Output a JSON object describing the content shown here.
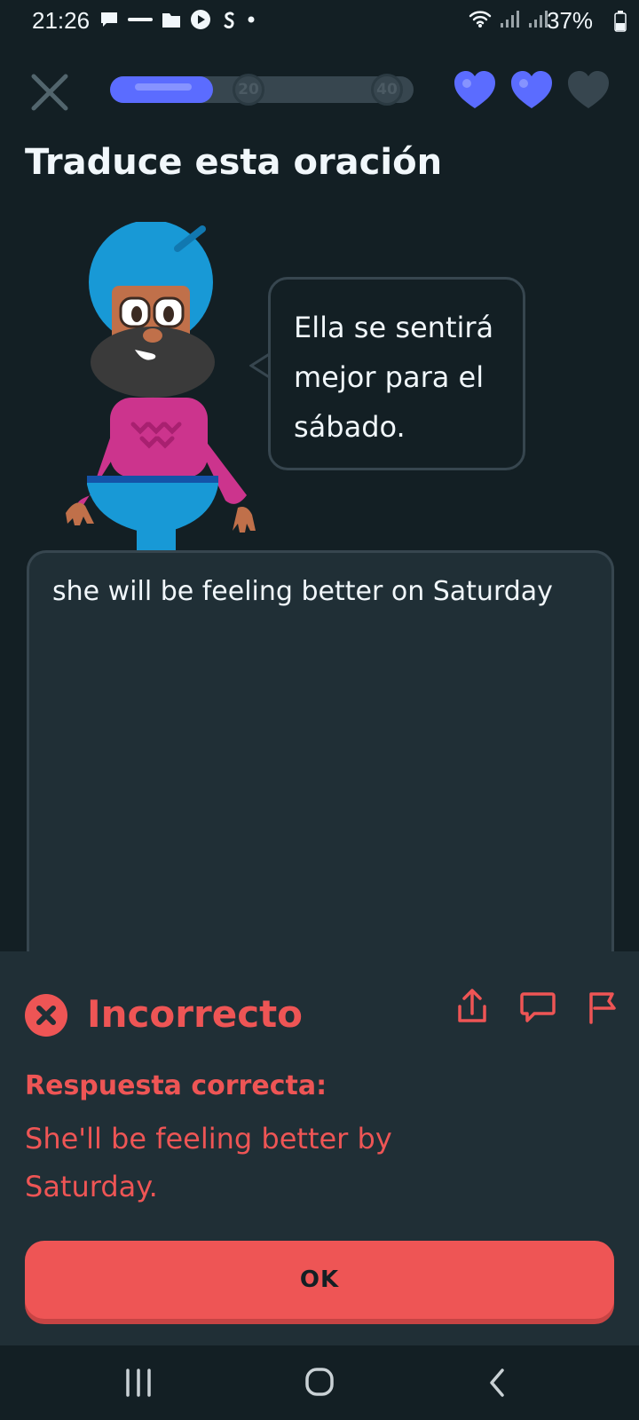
{
  "status_bar": {
    "time": "21:26",
    "battery": "37%",
    "left_icons": [
      "chat-bubble-icon",
      "coursera-icon",
      "folder-icon",
      "play-icon",
      "shazam-icon",
      "dot-icon"
    ],
    "right_icons": [
      "wifi-icon",
      "signal-icon",
      "signal-icon",
      "battery-icon"
    ]
  },
  "top_bar": {
    "progress_fraction": 0.34,
    "milestones": [
      "20",
      "40"
    ],
    "hearts_total": 3,
    "hearts_filled": 2,
    "colors": {
      "accent": "#5b6cff",
      "heart_empty": "#37464f"
    }
  },
  "title": "Traduce esta oración",
  "prompt": {
    "text": "Ella se sentirá mejor para el sábado."
  },
  "answer": {
    "value": "she will be feeling better on Saturday"
  },
  "feedback": {
    "status": "Incorrecto",
    "label": "Respuesta correcta:",
    "correct_answer": "She'll be feeling better by Saturday.",
    "button": "OK",
    "colors": {
      "error": "#ee5555"
    },
    "action_icons": [
      "share-icon",
      "comment-icon",
      "report-flag-icon"
    ]
  },
  "nav_bar": {
    "buttons": [
      "recent-apps-icon",
      "home-icon",
      "back-icon"
    ]
  }
}
